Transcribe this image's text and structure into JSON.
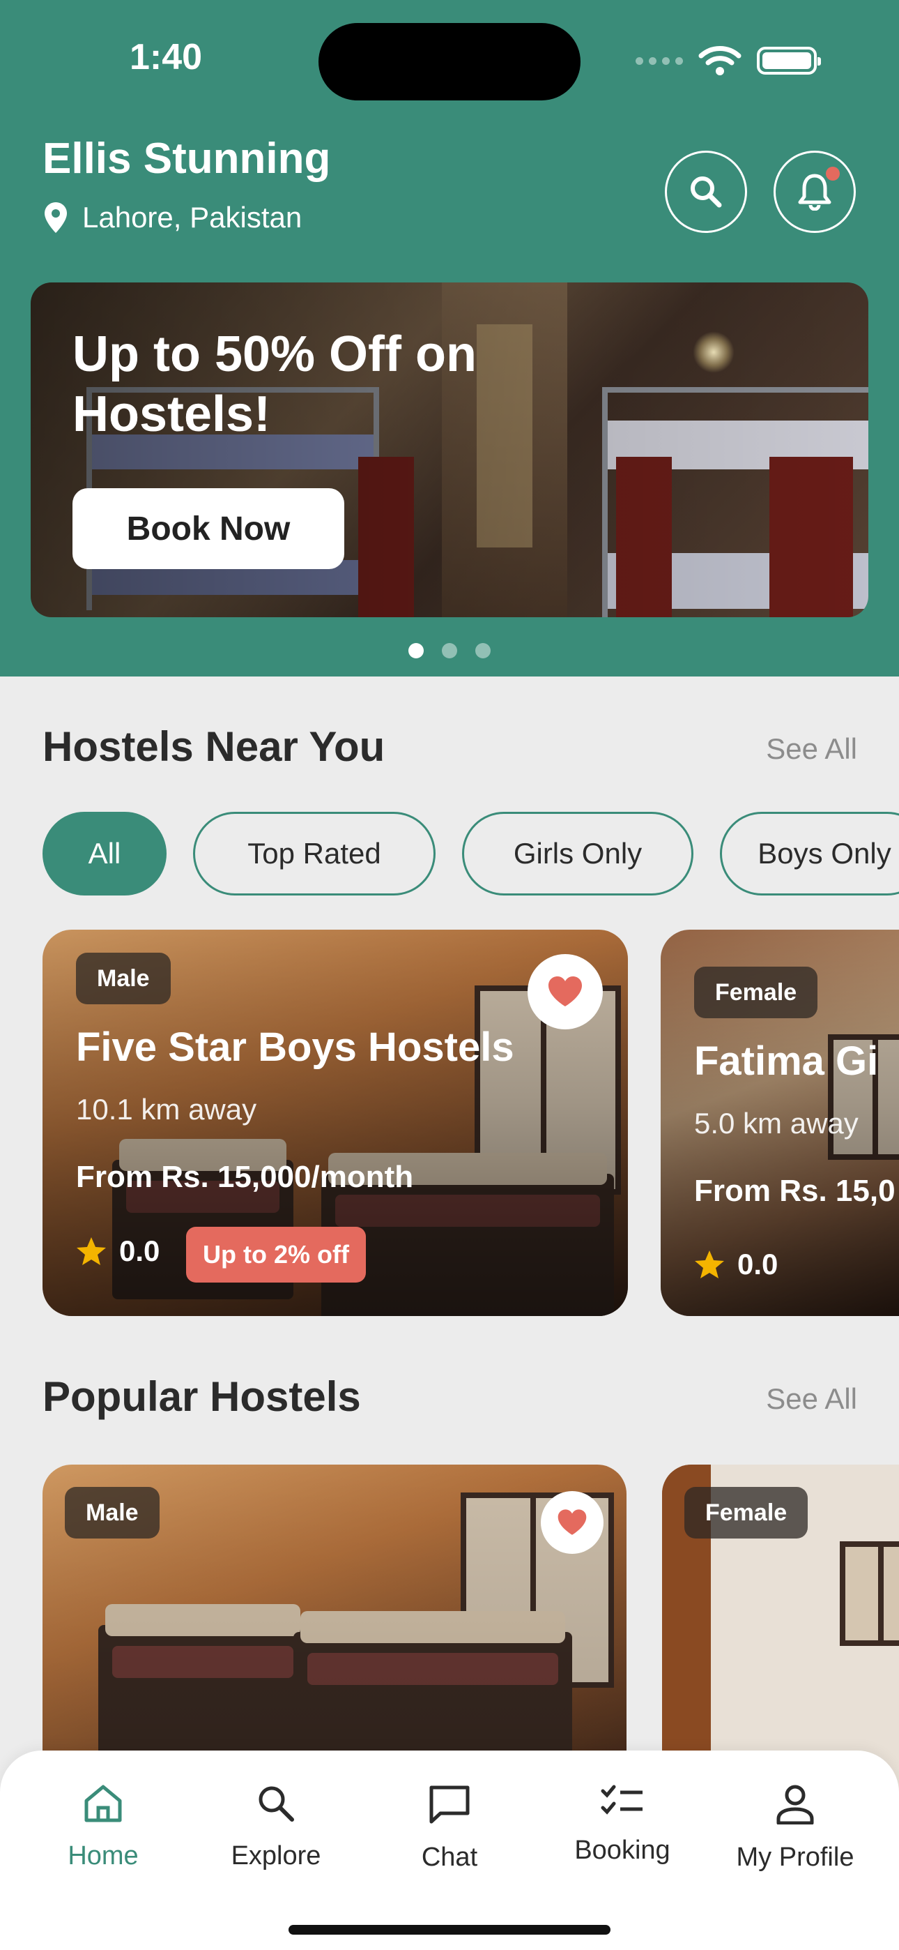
{
  "status_bar": {
    "time": "1:40"
  },
  "header": {
    "user_name": "Ellis Stunning",
    "location": "Lahore, Pakistan",
    "icons": {
      "location": "map-pin-icon",
      "search": "search-icon",
      "notifications": "bell-icon"
    }
  },
  "banner": {
    "title": "Up to 50% Off on Hostels!",
    "button_label": "Book Now",
    "slides": 3,
    "active_slide": 1
  },
  "near_you": {
    "title": "Hostels Near You",
    "see_all": "See All",
    "filters": [
      {
        "label": "All",
        "active": true
      },
      {
        "label": "Top Rated",
        "active": false
      },
      {
        "label": "Girls Only",
        "active": false
      },
      {
        "label": "Boys Only",
        "active": false
      }
    ],
    "cards": [
      {
        "tag": "Male",
        "name": "Five Star Boys Hostels",
        "distance": "10.1 km away",
        "price": "From Rs. 15,000/month",
        "rating": "0.0",
        "discount": "Up to 2% off",
        "favorite": true
      },
      {
        "tag": "Female",
        "name": "Fatima Gi",
        "distance": "5.0 km away",
        "price": "From Rs. 15,0",
        "rating": "0.0"
      }
    ]
  },
  "popular": {
    "title": "Popular Hostels",
    "see_all": "See All",
    "cards": [
      {
        "tag": "Male",
        "favorite": true
      },
      {
        "tag": "Female"
      }
    ]
  },
  "bottom_nav": {
    "items": [
      {
        "label": "Home",
        "icon": "home-icon",
        "active": true
      },
      {
        "label": "Explore",
        "icon": "search-icon",
        "active": false
      },
      {
        "label": "Chat",
        "icon": "chat-icon",
        "active": false
      },
      {
        "label": "Booking",
        "icon": "checklist-icon",
        "active": false
      },
      {
        "label": "My Profile",
        "icon": "user-icon",
        "active": false
      }
    ]
  },
  "colors": {
    "primary": "#3a8c79",
    "accent": "#e46a5e",
    "star": "#f4b400",
    "background": "#ececec"
  }
}
